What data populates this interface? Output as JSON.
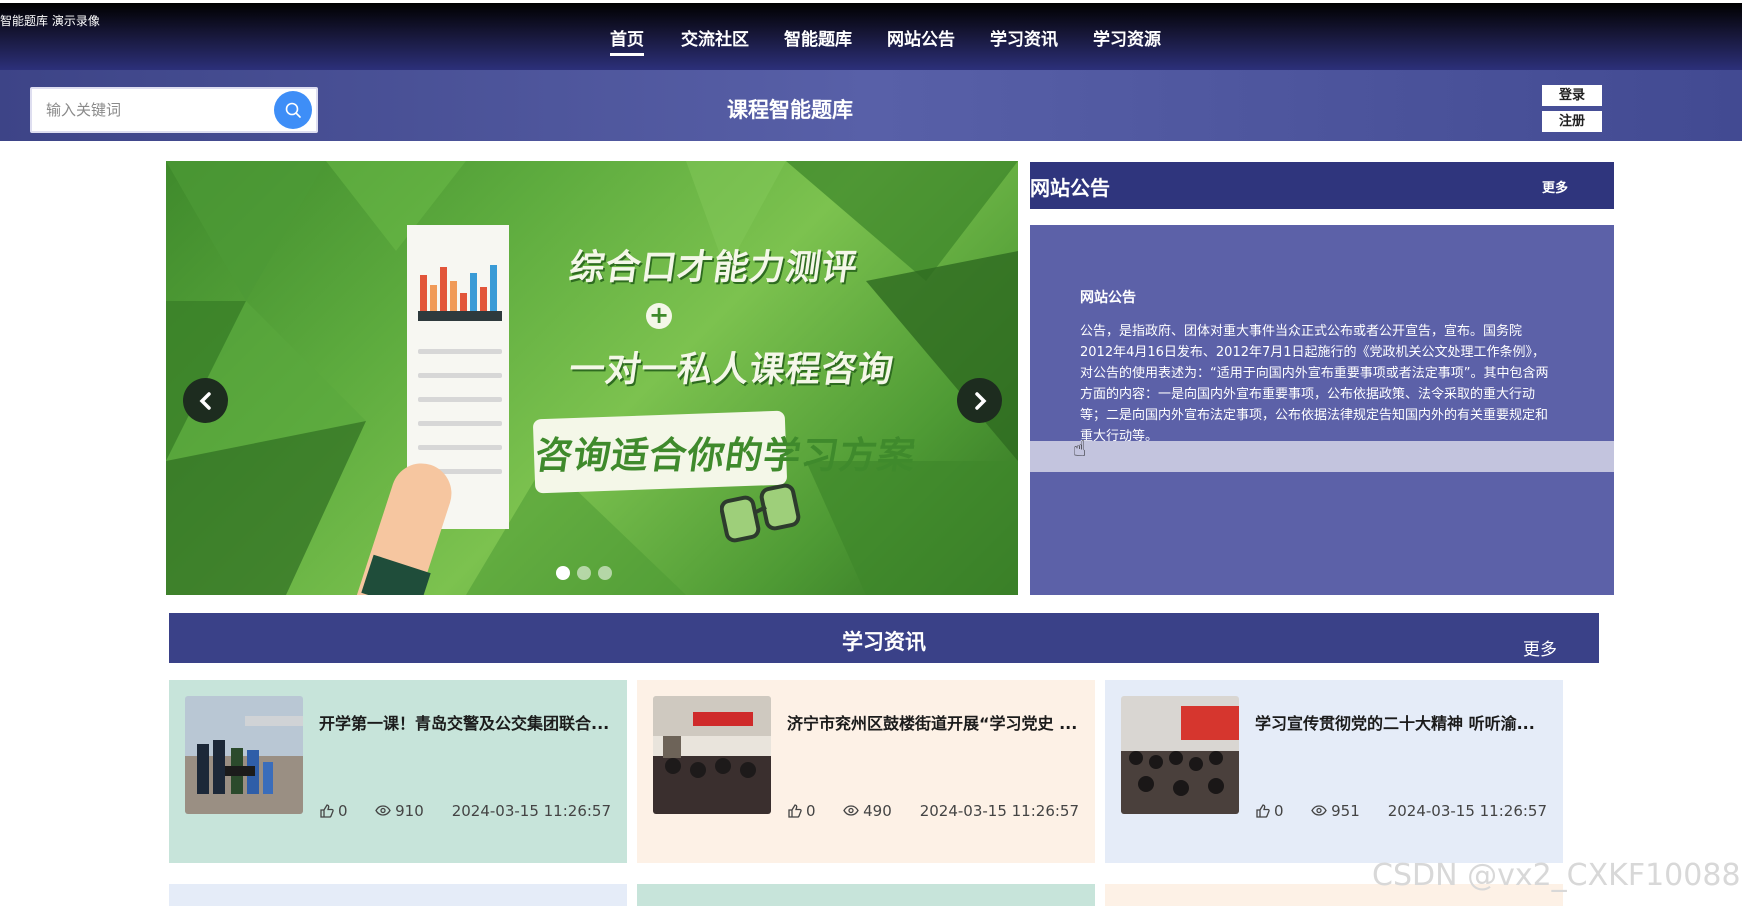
{
  "recording_label": "智能题库 演示录像",
  "nav": {
    "items": [
      "首页",
      "交流社区",
      "智能题库",
      "网站公告",
      "学习资讯",
      "学习资源"
    ],
    "active_index": 0
  },
  "header": {
    "search_placeholder": "输入关键词",
    "site_title": "课程智能题库",
    "login_label": "登录",
    "register_label": "注册"
  },
  "carousel": {
    "line1": "综合口才能力测评",
    "plus": "+",
    "line2": "一对一私人课程咨询",
    "line3": "咨询适合你的学习方案",
    "dot_count": 3,
    "active_dot": 0,
    "prev_icon": "chevron-left-icon",
    "next_icon": "chevron-right-icon"
  },
  "announcements": {
    "title": "网站公告",
    "more_label": "更多",
    "item_title": "网站公告",
    "item_text": "公告，是指政府、团体对重大事件当众正式公布或者公开宣告，宣布。国务院2012年4月16日发布、2012年7月1日起施行的《党政机关公文处理工作条例》，对公告的使用表述为：“适用于向国内外宣布重要事项或者法定事项”。其中包含两方面的内容：一是向国内外宣布重要事项，公布依据政策、法令采取的重大行动等；二是向国内外宣布法定事项，公布依据法律规定告知国内外的有关重要规定和重大行动等。"
  },
  "news": {
    "title": "学习资讯",
    "more_label": "更多",
    "cards": [
      {
        "title": "开学第一课！青岛交警及公交集团联合...",
        "likes": "0",
        "views": "910",
        "date": "2024-03-15 11:26:57",
        "bg": "#c7e4da"
      },
      {
        "title": "济宁市兖州区鼓楼街道开展“学习党史 ...",
        "likes": "0",
        "views": "490",
        "date": "2024-03-15 11:26:57",
        "bg": "#fdf1e6"
      },
      {
        "title": "学习宣传贯彻党的二十大精神 听听渝...",
        "likes": "0",
        "views": "951",
        "date": "2024-03-15 11:26:57",
        "bg": "#e5ecf8"
      }
    ],
    "row2_colors": [
      "#e5ecf8",
      "#c7e4da",
      "#fdf1e6"
    ]
  },
  "watermark": "CSDN @vx2_CXKF10088",
  "colors": {
    "nav_gradient_bottom": "#2c307a",
    "header": "#5860a8",
    "search_button": "#3e8ef7",
    "ann_header": "#2f357d",
    "ann_body": "#5c61a8",
    "news_header": "#3a4188"
  }
}
